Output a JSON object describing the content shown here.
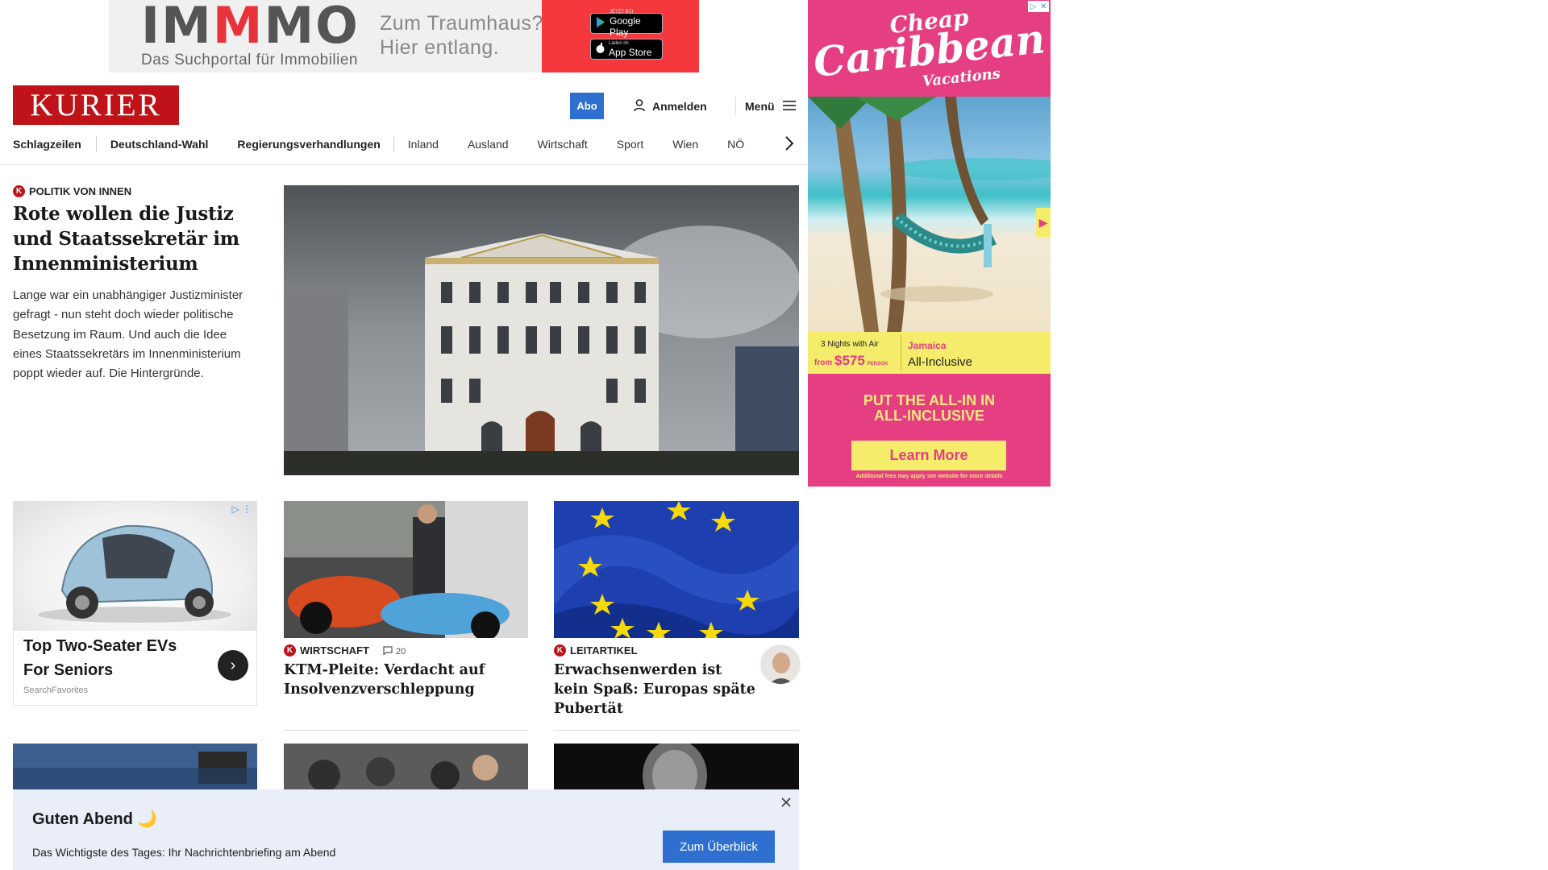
{
  "top_ad": {
    "brand_prefix": "IM",
    "brand_accent": "M",
    "brand_suffix": "MO",
    "tagline": "Das Suchportal für Immobilien",
    "slogan_line1": "Zum Traumhaus?",
    "slogan_line2": "Hier entlang.",
    "google_play_small": "JETZT BEI",
    "google_play": "Google Play",
    "app_store_small": "Laden im",
    "app_store": "App Store",
    "accent_color": "#e8333a"
  },
  "side_ad": {
    "logo_line1": "Cheap",
    "logo_line2": "Caribbean",
    "logo_line3": "Vacations",
    "nights": "3 Nights with Air",
    "from": "from",
    "price": "$575",
    "per": "PERSON",
    "destination": "Jamaica",
    "package": "All-Inclusive",
    "headline_line1": "PUT THE ALL-IN IN",
    "headline_line2": "ALL-INCLUSIVE",
    "cta": "Learn More",
    "fineprint": "Additional fees may apply see website for more details",
    "bg_color": "#e53e83",
    "accent_color": "#f4ec6a"
  },
  "header": {
    "logo": "KURIER",
    "abo": "Abo",
    "login": "Anmelden",
    "menu": "Menü",
    "brand_color": "#bf1319",
    "button_color": "#2f6fd0"
  },
  "nav": {
    "items": [
      "Schlagzeilen",
      "Deutschland-Wahl",
      "Regierungsverhandlungen",
      "Inland",
      "Ausland",
      "Wirtschaft",
      "Sport",
      "Wien",
      "NÖ"
    ]
  },
  "lead": {
    "kicker": "Politik von innen",
    "title": "Rote wollen die Justiz und Staatssekretär im Innenministerium",
    "teaser": "Lange war ein unabhängiger Justizminister gefragt - nun steht doch wieder politische Besetzung im Raum. Und auch die Idee eines Staatssekretärs im Innenministerium poppt wieder auf. Die Hintergründe."
  },
  "sponsored": {
    "title": "Top Two-Seater EVs For Seniors",
    "source": "SearchFavorites"
  },
  "articles": [
    {
      "kicker": "Wirtschaft",
      "comments": "20",
      "title": "KTM-Pleite: Verdacht auf Insolvenzverschleppung"
    },
    {
      "kicker": "Leitartikel",
      "title": "Erwachsenwerden ist kein Spaß: Europas späte Pubertät"
    }
  ],
  "briefing": {
    "greeting": "Guten Abend 🌙",
    "message": "Das Wichtigste des Tages: Ihr Nachrichtenbriefing am Abend",
    "cta": "Zum Überblick"
  }
}
